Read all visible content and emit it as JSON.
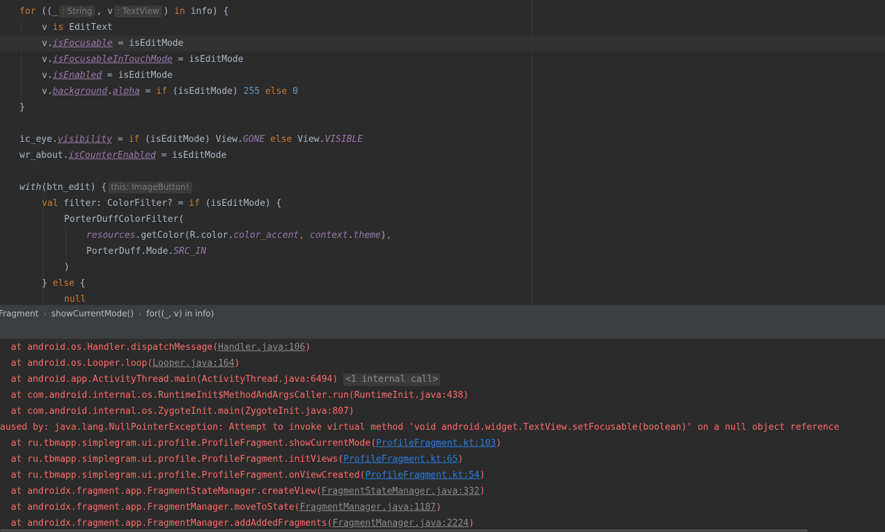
{
  "editor": {
    "line_for_kw": "for",
    "line_for_open": " ((",
    "line_for_underscore": "_",
    "hint_string": ": String",
    "line_for_comma": ", v",
    "hint_textview": ": TextView",
    "line_for_in": ") ",
    "kw_in": "in",
    "line_for_tail": " info) {",
    "l2_a": "v ",
    "l2_is": "is",
    "l2_b": " EditText",
    "l3_a": "v.",
    "l3_prop": "isFocusable",
    "l3_b": " = isEditMode",
    "l4_a": "v.",
    "l4_prop": "isFocusableInTouchMode",
    "l4_b": " = isEditMode",
    "l5_a": "v.",
    "l5_prop": "isEnabled",
    "l5_b": " = isEditMode",
    "l6_a": "v.",
    "l6_prop1": "background",
    "l6_dot": ".",
    "l6_prop2": "alpha",
    "l6_b": " = ",
    "l6_if": "if",
    "l6_c": " (isEditMode) ",
    "l6_n255": "255",
    "l6_else": " else ",
    "l6_n0": "0",
    "l7": "}",
    "l9_a": "ic_eye.",
    "l9_prop": "visibility",
    "l9_b": " = ",
    "l9_if": "if",
    "l9_c": " (isEditMode) View.",
    "l9_gone": "GONE",
    "l9_else": " else ",
    "l9_d": "View.",
    "l9_visible": "VISIBLE",
    "l10_a": "wr_about.",
    "l10_prop": "isCounterEnabled",
    "l10_b": " = isEditMode",
    "l12_with": "with",
    "l12_a": "(btn_edit) {",
    "hint_this": "this: ImageButton!",
    "l13_val": "val",
    "l13_a": " filter: ColorFilter? = ",
    "l13_if": "if",
    "l13_b": " (isEditMode) {",
    "l14": "PorterDuffColorFilter(",
    "l15_res": "resources",
    "l15_a": ".getColor(R.color.",
    "l15_accent": "color_accent",
    "l15_comma": ", ",
    "l15_ctx": "context",
    "l15_dot": ".",
    "l15_theme": "theme",
    "l15_close": ")",
    "l15_trail": ",",
    "l16_a": "PorterDuff.Mode.",
    "l16_src": "SRC_IN",
    "l17": ")",
    "l18_a": "} ",
    "l18_else": "else",
    "l18_b": " {",
    "l19_null": "null"
  },
  "breadcrumbs": [
    "Fragment",
    "showCurrentMode()",
    "for((_, v) in info)"
  ],
  "console": {
    "lines": [
      {
        "prefix": "  at android.os.Handler.dispatchMessage(",
        "link": "Handler.java:106",
        "link_style": "grey",
        "suffix": ")"
      },
      {
        "prefix": "  at android.os.Looper.loop(",
        "link": "Looper.java:164",
        "link_style": "grey",
        "suffix": ")"
      },
      {
        "prefix": "  at android.app.ActivityThread.main(ActivityThread.java:6494)",
        "badge": "<1 internal call>"
      },
      {
        "prefix": "  at com.android.internal.os.RuntimeInit$MethodAndArgsCaller.run(RuntimeInit.java:438)"
      },
      {
        "prefix": "  at com.android.internal.os.ZygoteInit.main(ZygoteInit.java:807)"
      },
      {
        "prefix": "aused by: java.lang.NullPointerException: Attempt to invoke virtual method 'void android.widget.TextView.setFocusable(boolean)' on a null object reference"
      },
      {
        "prefix": "  at ru.tbmapp.simplegram.ui.profile.ProfileFragment.showCurrentMode(",
        "link": "ProfileFragment.kt:103",
        "link_style": "blue",
        "suffix": ")"
      },
      {
        "prefix": "  at ru.tbmapp.simplegram.ui.profile.ProfileFragment.initViews(",
        "link": "ProfileFragment.kt:65",
        "link_style": "blue",
        "suffix": ")"
      },
      {
        "prefix": "  at ru.tbmapp.simplegram.ui.profile.ProfileFragment.onViewCreated(",
        "link": "ProfileFragment.kt:54",
        "link_style": "blue",
        "suffix": ")"
      },
      {
        "prefix": "  at androidx.fragment.app.FragmentStateManager.createView(",
        "link": "FragmentStateManager.java:332",
        "link_style": "grey",
        "suffix": ")"
      },
      {
        "prefix": "  at androidx.fragment.app.FragmentManager.moveToState(",
        "link": "FragmentManager.java:1187",
        "link_style": "grey",
        "suffix": ")"
      },
      {
        "prefix": "  at androidx.fragment.app.FragmentManager.addAddedFragments(",
        "link": "FragmentManager.java:2224",
        "link_style": "grey",
        "suffix": ")"
      }
    ]
  },
  "colors": {
    "background": "#2b2b2b",
    "keyword": "#cc7832",
    "property": "#9876aa",
    "number": "#6897bb",
    "error": "#ff6b68",
    "link_blue": "#287bde"
  }
}
